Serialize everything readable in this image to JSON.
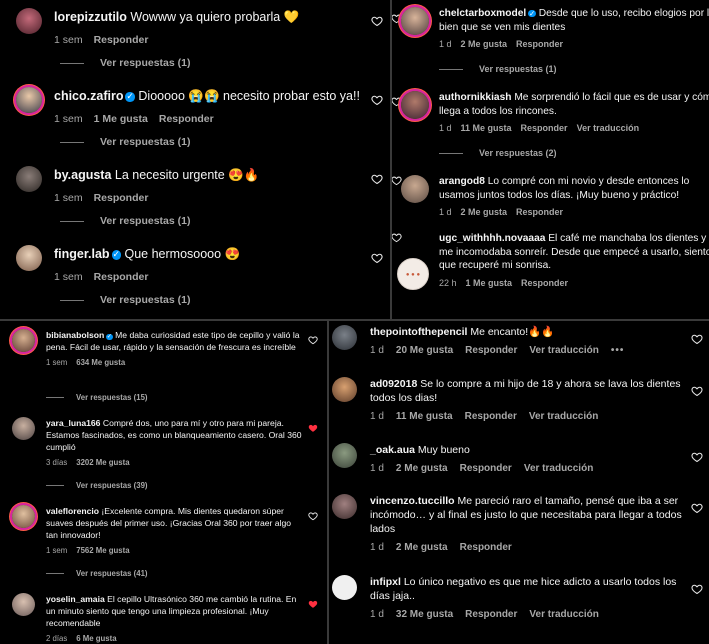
{
  "panel1": {
    "comments": [
      {
        "user": "lorepizzutilo",
        "verified": false,
        "text": "Wowww ya quiero probarla 💛",
        "time": "1 sem",
        "likes": "",
        "reply": "Responder",
        "replies": "Ver respuestas (1)",
        "liked": false
      },
      {
        "user": "chico.zafiro",
        "verified": true,
        "text": "Diooooo 😭😭 necesito probar esto ya!!",
        "time": "1 sem",
        "likes": "1 Me gusta",
        "reply": "Responder",
        "replies": "Ver respuestas (1)",
        "liked": false
      },
      {
        "user": "by.agusta",
        "verified": false,
        "text": "La necesito urgente 😍🔥",
        "time": "1 sem",
        "likes": "",
        "reply": "Responder",
        "replies": "Ver respuestas (1)",
        "liked": false
      },
      {
        "user": "finger.lab",
        "verified": true,
        "text": "Que hermosoooo 😍",
        "time": "1 sem",
        "likes": "",
        "reply": "Responder",
        "replies": "Ver respuestas (1)",
        "liked": false
      }
    ]
  },
  "panel2": {
    "comments": [
      {
        "user": "chelctarboxmodel",
        "verified": true,
        "text_lines": [
          "Desde que lo uso, recibo elogios por lo",
          "bien que se ven mis dientes"
        ],
        "time": "1 d",
        "likes": "2 Me gusta",
        "reply": "Responder",
        "translate": "",
        "replies": "Ver respuestas (1)"
      },
      {
        "user": "authornikkiash",
        "verified": false,
        "text_lines": [
          "Me sorprendió lo fácil que es de usar y cómo",
          "llega a todos los rincones."
        ],
        "time": "1 d",
        "likes": "11 Me gusta",
        "reply": "Responder",
        "translate": "Ver traducción",
        "replies": "Ver respuestas (2)"
      },
      {
        "user": "arangod8",
        "verified": false,
        "text_lines": [
          "Lo compré con mi novio y desde entonces lo",
          "usamos juntos todos los días. ¡Muy bueno y práctico!"
        ],
        "time": "1 d",
        "likes": "2 Me gusta",
        "reply": "Responder",
        "translate": "",
        "replies": ""
      },
      {
        "user": "ugc_withhhh.novaaaa",
        "verified": false,
        "text_lines": [
          "El café me manchaba los dientes y",
          "me incomodaba sonreír. Desde que empecé a usarlo, siento",
          "que recuperé mi sonrisa."
        ],
        "time": "22 h",
        "likes": "1 Me gusta",
        "reply": "Responder",
        "translate": "",
        "replies": ""
      }
    ]
  },
  "panel3": {
    "comments": [
      {
        "user": "bibianabolson",
        "verified": true,
        "text": "Me daba curiosidad este tipo de cepillo y valió la pena. Fácil de usar, rápido y la sensación de frescura es increíble",
        "time": "1 sem",
        "likes": "634 Me gusta",
        "replies": "Ver respuestas (15)",
        "liked": false
      },
      {
        "user": "yara_luna166",
        "verified": false,
        "text": "Compré dos, uno para mí y otro para mi pareja. Estamos fascinados, es como un blanqueamiento casero. Oral 360 cumplió",
        "time": "3 días",
        "likes": "3202 Me gusta",
        "replies": "Ver respuestas (39)",
        "liked": true
      },
      {
        "user": "valeflorencio",
        "verified": false,
        "text": "¡Excelente compra. Mis dientes quedaron súper suaves después del primer uso. ¡Gracias Oral 360 por traer algo tan innovador!",
        "time": "1 sem",
        "likes": "7562 Me gusta",
        "replies": "Ver respuestas (41)",
        "liked": false
      },
      {
        "user": "yoselin_amaia",
        "verified": false,
        "text": "El cepillo Ultrasónico 360 me cambió la rutina. En un minuto siento que tengo una limpieza profesional. ¡Muy recomendable",
        "time": "2 días",
        "likes": "6 Me gusta",
        "replies": "",
        "liked": true
      }
    ]
  },
  "panel4": {
    "comments": [
      {
        "user": "thepointofthepencil",
        "text": "Me encanto!🔥🔥",
        "time": "1 d",
        "likes": "20 Me gusta",
        "reply": "Responder",
        "translate": "Ver traducción",
        "more": "•••"
      },
      {
        "user": "ad092018",
        "text": "Se lo compre a mi hijo de 18 y ahora se lava los dientes todos los dias!",
        "time": "1 d",
        "likes": "11 Me gusta",
        "reply": "Responder",
        "translate": "Ver traducción",
        "more": ""
      },
      {
        "user": "_oak.aua",
        "text": "Muy bueno",
        "time": "1 d",
        "likes": "2 Me gusta",
        "reply": "Responder",
        "translate": "Ver traducción",
        "more": ""
      },
      {
        "user": "vincenzo.tuccillo",
        "text": "Me pareció raro el tamaño, pensé que iba a ser incómodo… y al final es justo lo que necesitaba para llegar a todos lados",
        "time": "1 d",
        "likes": "2 Me gusta",
        "reply": "Responder",
        "translate": "",
        "more": ""
      },
      {
        "user": "infipxl",
        "text": "Lo único negativo es que me hice adicto a usarlo todos los días jaja..",
        "time": "1 d",
        "likes": "32 Me gusta",
        "reply": "Responder",
        "translate": "Ver traducción",
        "more": ""
      }
    ]
  },
  "icons": {
    "heart": "heart-icon",
    "verified": "verified-badge-icon"
  },
  "colors": {
    "background": "#000000",
    "muted": "#a8a8a8",
    "verified": "#0095f6",
    "liked": "#ff3040"
  }
}
